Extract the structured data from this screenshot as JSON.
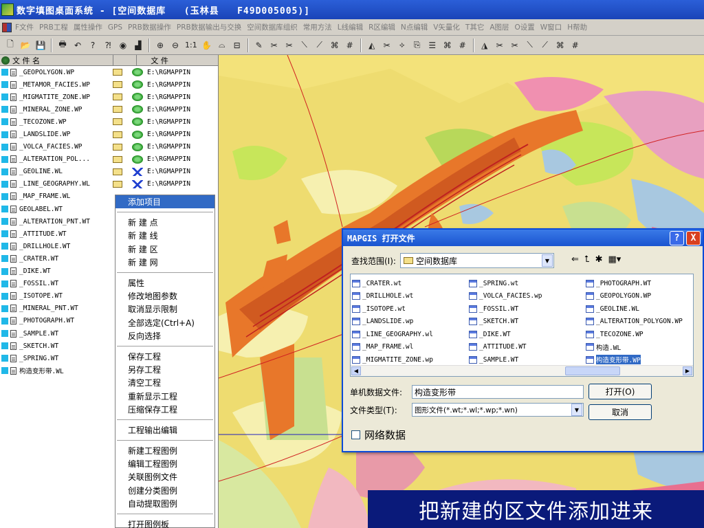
{
  "window": {
    "title": "数字填图桌面系统 - [空间数据库   (玉林县   F49D005005)]"
  },
  "menu": [
    "F文件",
    "PRB工程",
    "属性操作",
    "GPS",
    "PRB数据操作",
    "PRB数据输出与交换",
    "空间数据库组织",
    "常用方法",
    "L线编辑",
    "R区编辑",
    "N点编辑",
    "V矢量化",
    "T其它",
    "A图层",
    "O设置",
    "W窗口",
    "H帮助"
  ],
  "toolbar": {
    "zoom_label": "1:1"
  },
  "file_panel": {
    "col_name": "文 件 名",
    "col_file": "文 件",
    "rows": [
      {
        "name": "_GEOPOLYGON.WP",
        "path": "E:\\RGMAPPIN",
        "status": "green"
      },
      {
        "name": "_METAMOR_FACIES.WP",
        "path": "E:\\RGMAPPIN",
        "status": "green"
      },
      {
        "name": "_MIGMATITE_ZONE.WP",
        "path": "E:\\RGMAPPIN",
        "status": "green"
      },
      {
        "name": "_MINERAL_ZONE.WP",
        "path": "E:\\RGMAPPIN",
        "status": "green"
      },
      {
        "name": "_TECOZONE.WP",
        "path": "E:\\RGMAPPIN",
        "status": "green"
      },
      {
        "name": "_LANDSLIDE.WP",
        "path": "E:\\RGMAPPIN",
        "status": "green"
      },
      {
        "name": "_VOLCA_FACIES.WP",
        "path": "E:\\RGMAPPIN",
        "status": "green"
      },
      {
        "name": "_ALTERATION_POL...",
        "path": "E:\\RGMAPPIN",
        "status": "green"
      },
      {
        "name": "_GEOLINE.WL",
        "path": "E:\\RGMAPPIN",
        "status": "blue"
      },
      {
        "name": "_LINE_GEOGRAPHY.WL",
        "path": "E:\\RGMAPPIN",
        "status": "blue"
      },
      {
        "name": "_MAP_FRAME.WL"
      },
      {
        "name": "GEOLABEL.WT"
      },
      {
        "name": "_ALTERATION_PNT.WT"
      },
      {
        "name": "_ATTITUDE.WT"
      },
      {
        "name": "_DRILLHOLE.WT"
      },
      {
        "name": "_CRATER.WT"
      },
      {
        "name": "_DIKE.WT"
      },
      {
        "name": "_FOSSIL.WT"
      },
      {
        "name": "_ISOTOPE.WT"
      },
      {
        "name": "_MINERAL_PNT.WT"
      },
      {
        "name": "_PHOTOGRAPH.WT"
      },
      {
        "name": "_SAMPLE.WT"
      },
      {
        "name": "_SKETCH.WT"
      },
      {
        "name": "_SPRING.WT"
      },
      {
        "name": "构造变形带.WL"
      }
    ]
  },
  "context_menu": [
    [
      "添加项目"
    ],
    [
      "新 建 点",
      "新 建 线",
      "新 建 区",
      "新 建 网"
    ],
    [
      "属性",
      "修改地图参数",
      "取消显示限制",
      "全部选定(Ctrl+A)",
      "反向选择"
    ],
    [
      "保存工程",
      "另存工程",
      "清空工程",
      "重新显示工程",
      "压缩保存工程"
    ],
    [
      "工程输出编辑"
    ],
    [
      "新建工程图例",
      "编辑工程图例",
      "关联图例文件",
      "创建分类图例",
      "自动提取图例"
    ],
    [
      "打开图例板"
    ]
  ],
  "dialog": {
    "title": "MAPGIS 打开文件",
    "look_in_label": "查找范围(I):",
    "look_in_value": "空间数据库",
    "columns": [
      [
        "_CRATER.wt",
        "_DRILLHOLE.wt",
        "_ISOTOPE.wt",
        "_LANDSLIDE.wp",
        "_LINE_GEOGRAPHY.wl",
        "_MAP_FRAME.wl",
        "_MIGMATITE_ZONE.wp"
      ],
      [
        "_SPRING.wt",
        "_VOLCA_FACIES.wp",
        "_FOSSIL.WT",
        "_SKETCH.WT",
        "_DIKE.WT",
        "_ATTITUDE.WT",
        "_SAMPLE.WT"
      ],
      [
        "_PHOTOGRAPH.WT",
        "_GEOPOLYGON.WP",
        "_GEOLINE.WL",
        "_ALTERATION_POLYGON.WP",
        "_TECOZONE.WP",
        "构造.WL",
        "构造变形带.WP"
      ]
    ],
    "selected_file": "构造变形带.WP",
    "filename_label": "单机数据文件:",
    "filename_value": "构造变形带",
    "filetype_label": "文件类型(T):",
    "filetype_value": "图形文件(*.wt;*.wl;*.wp;*.wn)",
    "open_button": "打开(O)",
    "cancel_button": "取消",
    "network_checkbox": "网络数据",
    "help_button": "?",
    "close_button": "X"
  },
  "caption": "把新建的区文件添加进来",
  "colors": {
    "title_bar": "#1a44b8",
    "map_base": "#eedc70",
    "highlight": "#316ac5",
    "caption_bg": "#0a1a7a"
  }
}
